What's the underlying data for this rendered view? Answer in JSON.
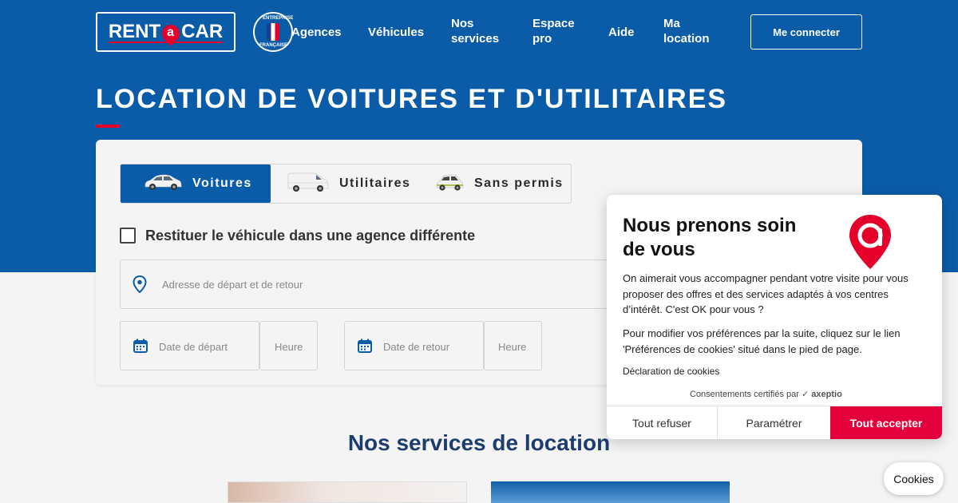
{
  "header": {
    "logo_text_left": "RENT",
    "logo_text_a": "a",
    "logo_text_right": "CAR",
    "badge_top": "ENTREPRISE",
    "badge_bottom": "FRANÇAISE",
    "nav": [
      {
        "label": "Agences"
      },
      {
        "label": "Véhicules"
      },
      {
        "label": "Nos services"
      },
      {
        "label": "Espace pro"
      },
      {
        "label": "Aide"
      },
      {
        "label": "Ma location"
      }
    ],
    "login_label": "Me connecter"
  },
  "hero": {
    "title": "LOCATION DE VOITURES ET D'UTILITAIRES"
  },
  "booking": {
    "tabs": [
      {
        "label": "Voitures",
        "icon": "car-icon",
        "active": true
      },
      {
        "label": "Utilitaires",
        "icon": "van-icon",
        "active": false
      },
      {
        "label": "Sans permis",
        "icon": "microcar-icon",
        "active": false
      }
    ],
    "return_checkbox_label": "Restituer le véhicule dans une agence différente",
    "address_placeholder": "Adresse de départ et de retour",
    "date_depart_placeholder": "Date de départ",
    "heure_depart_placeholder": "Heure",
    "date_retour_placeholder": "Date de retour",
    "heure_retour_placeholder": "Heure"
  },
  "services": {
    "title": "Nos services de location"
  },
  "cookie_modal": {
    "title": "Nous prenons soin de vous",
    "paragraph1": "On aimerait vous accompagner pendant votre visite pour vous proposer des offres et des services adaptés à vos centres d’intérêt.  C'est OK pour vous ?",
    "paragraph2": "Pour modifier vos préférences par la suite, cliquez sur le lien 'Préférences de cookies' situé dans le pied de page.",
    "declaration_link": "Déclaration de cookies",
    "certified_text": "Consentements certifiés par",
    "certified_brand": "axeptio",
    "refuse_label": "Tout refuser",
    "settings_label": "Paramétrer",
    "accept_label": "Tout accepter"
  },
  "cookies_button_label": "Cookies",
  "colors": {
    "brand_blue": "#0a5ca8",
    "brand_red": "#e4002b",
    "accept_red": "#e4003a",
    "services_title": "#1c3d6e"
  }
}
